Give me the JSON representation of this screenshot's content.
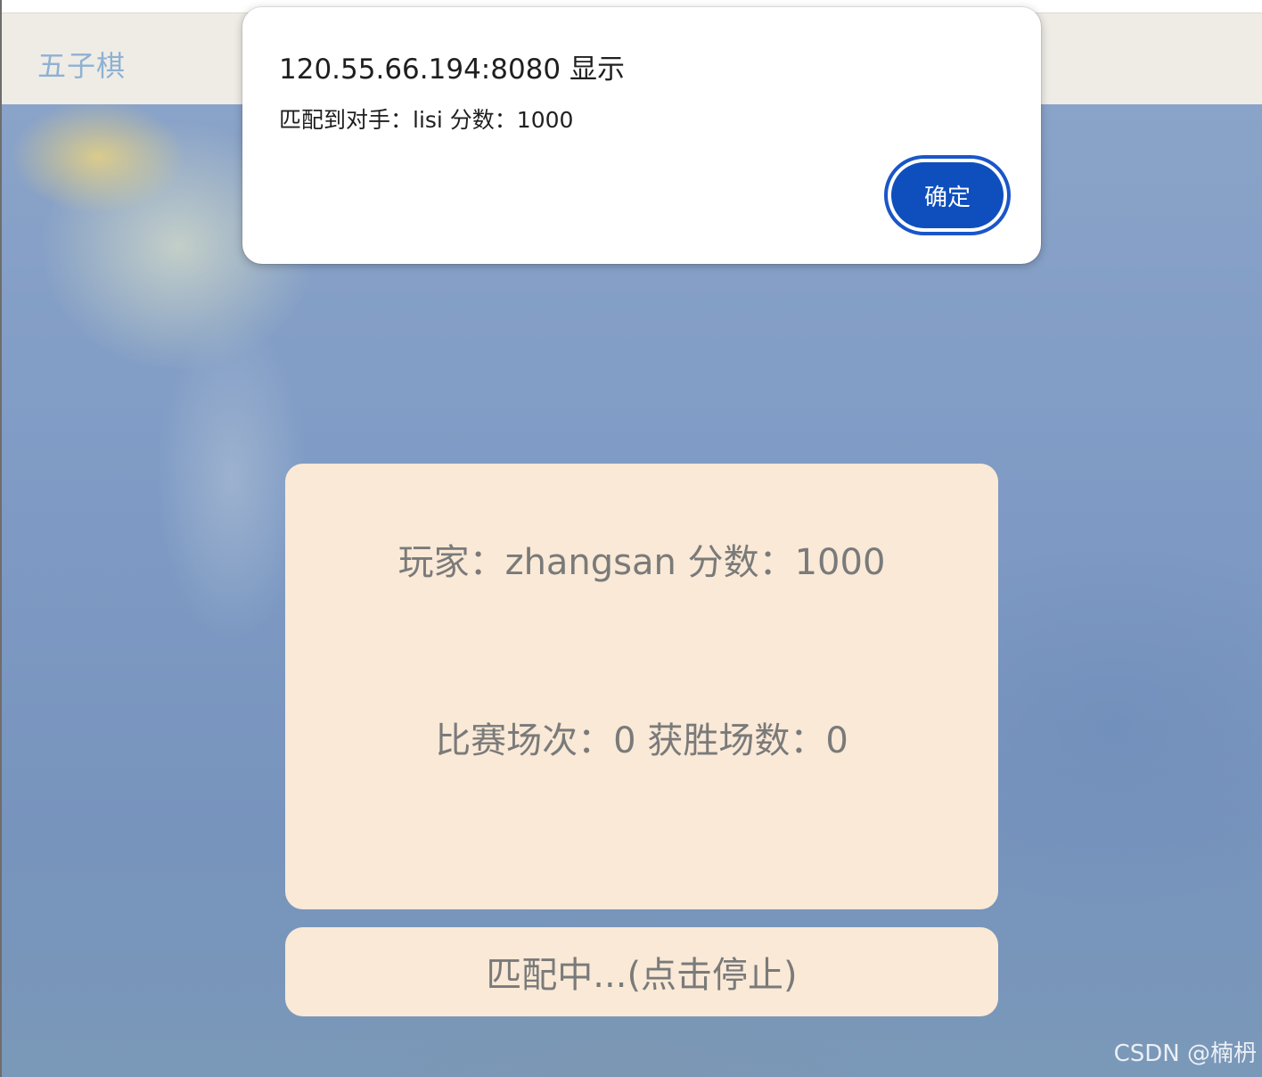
{
  "nav": {
    "title": "五子棋"
  },
  "dialog": {
    "title": "120.55.66.194:8080 显示",
    "message": "匹配到对手：lisi 分数：1000",
    "ok_label": "确定"
  },
  "card": {
    "player_line": "玩家：zhangsan 分数：1000",
    "stats_line": "比赛场次：0 获胜场数：0"
  },
  "match_button": {
    "label": "匹配中...(点击停止)"
  },
  "watermark": "CSDN @楠枬",
  "colors": {
    "nav_title": "#8eb1d3",
    "card_bg": "#f9e9d6",
    "dialog_button": "#0f4fbd"
  }
}
